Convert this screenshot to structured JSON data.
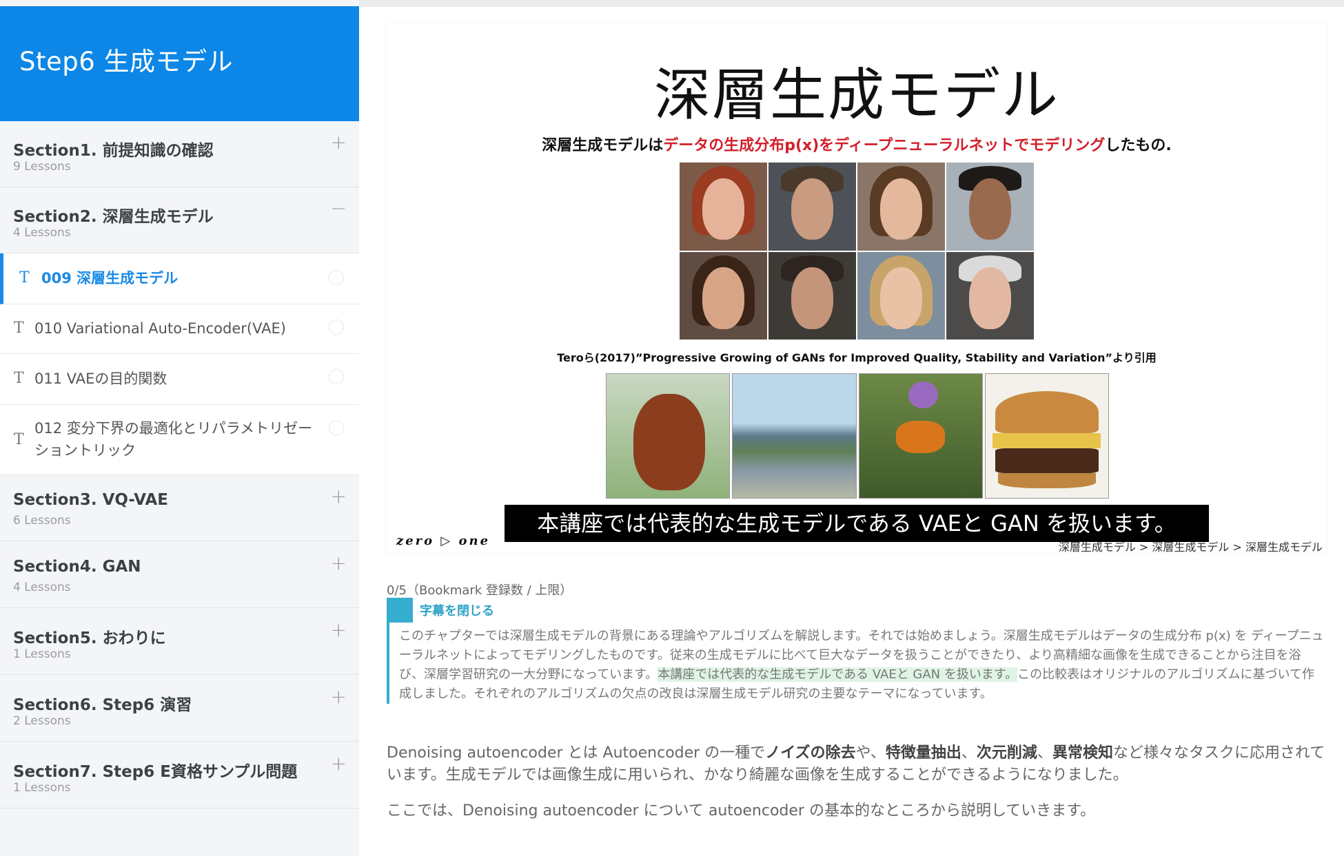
{
  "sidebar": {
    "header_title": "Step6 生成モデル",
    "sections": [
      {
        "title": "Section1. 前提知識の確認",
        "count": "9 Lessons",
        "toggle": "+"
      },
      {
        "title": "Section2. 深層生成モデル",
        "count": "4 Lessons",
        "toggle": "−"
      },
      {
        "title": "Section3. VQ-VAE",
        "count": "6 Lessons",
        "toggle": "+"
      },
      {
        "title": "Section4. GAN",
        "count": "4 Lessons",
        "toggle": "+"
      },
      {
        "title": "Section5. おわりに",
        "count": "1 Lessons",
        "toggle": "+"
      },
      {
        "title": "Section6. Step6 演習",
        "count": "2 Lessons",
        "toggle": "+"
      },
      {
        "title": "Section7. Step6 E資格サンプル問題",
        "count": "1 Lessons",
        "toggle": "+"
      }
    ],
    "lessons": [
      {
        "icon": "T",
        "title": "009 深層生成モデル"
      },
      {
        "icon": "T",
        "title": "010 Variational Auto-Encoder(VAE)"
      },
      {
        "icon": "T",
        "title": "011 VAEの目的関数"
      },
      {
        "icon": "T",
        "title": "012 変分下界の最適化とリパラメトリゼーショントリック"
      }
    ]
  },
  "slide": {
    "title": "深層生成モデル",
    "subtitle_part1": "深層生成モデルは",
    "subtitle_part2": "データの生成分布p(x)をディープニューラルネットでモデリング",
    "subtitle_part3": "したもの.",
    "citation": "Teroら(2017)”Progressive Growing of GANs for Improved Quality, Stability and Variation”より引用",
    "logo": "zero ▷ one",
    "breadcrumb": "深層生成モデル > 深層生成モデル > 深層生成モデル",
    "caption": "本講座では代表的な生成モデルである VAEと GAN を扱います。"
  },
  "colors": {
    "accent": "#0d87e7",
    "highlight_red": "#d21f2a",
    "subtitle_teal": "#35aed0"
  },
  "bookmark": {
    "count": "0/5（Bookmark 登録数 / 上限）"
  },
  "subtitles": {
    "toggle_label": "字幕を閉じる",
    "transcript_before": "このチャプターでは深層生成モデルの背景にある理論やアルゴリズムを解説します。それでは始めましょう。深層生成モデルはデータの生成分布 p(x) を ディープニューラルネットによってモデリングしたものです。従来の生成モデルに比べて巨大なデータを扱うことができたり、より高精細な画像を生成できることから注目を浴び、深層学習研究の一大分野になっています。",
    "transcript_highlight": "本講座では代表的な生成モデルである VAEと GAN を扱います。",
    "transcript_after": "この比較表はオリジナルのアルゴリズムに基づいて作成しました。それぞれのアルゴリズムの欠点の改良は深層生成モデル研究の主要なテーマになっています。"
  },
  "content": {
    "p1_a": "Denoising autoencoder とは Autoencoder の一種で",
    "p1_b": "ノイズの除去",
    "p1_c": "や、",
    "p1_d": "特徴量抽出",
    "p1_e": "、",
    "p1_f": "次元削減",
    "p1_g": "、",
    "p1_h": "異常検知",
    "p1_i": "など様々なタスクに応用されています。生成モデルでは画像生成に用いられ、かなり綺麗な画像を生成することができるようになりました。",
    "p2": "ここでは、Denoising autoencoder について autoencoder の基本的なところから説明していきます。"
  }
}
